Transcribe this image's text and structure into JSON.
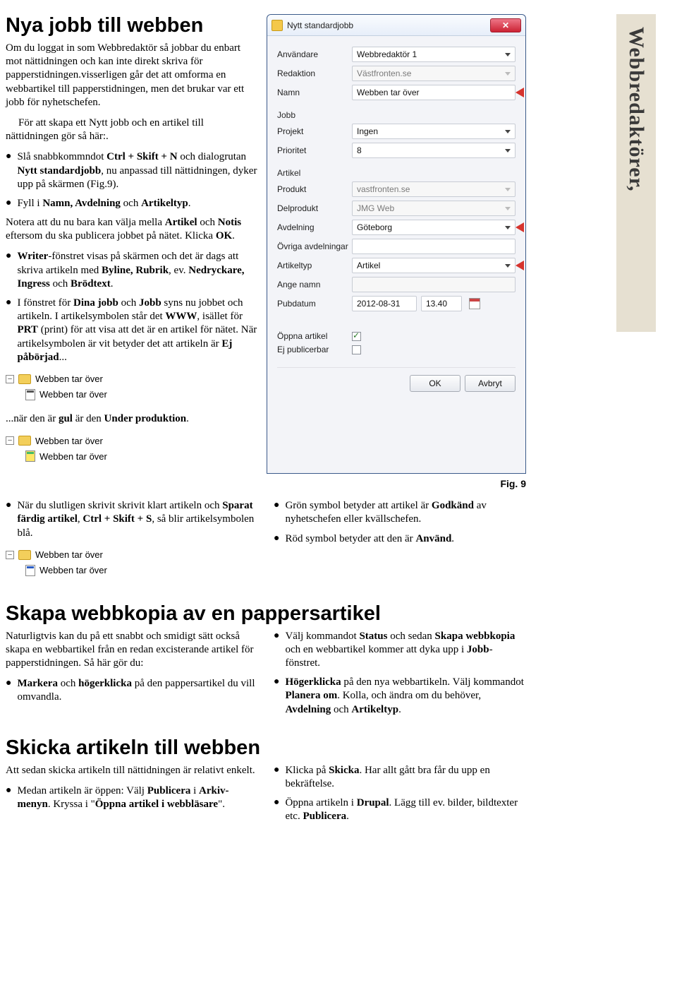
{
  "sideTab": "Webbredaktörer,",
  "h1": "Nya jobb till webben",
  "intro": "Om du loggat in som Webbredaktör så jobbar du enbart mot nättidningen och kan inte direkt skriva för papperstidningen.visserligen går det att omforma en webbartikel till papperstidningen, men det brukar var ett jobb för nyhetschefen.",
  "lead": "För att skapa ett Nytt jobb och en artikel till nättidningen gör så här:.",
  "bul1": {
    "pre": "Slå snabbkommndot ",
    "b1": "Ctrl + Skift + N",
    "mid": " och dialogrutan ",
    "b2": "Nytt standardjobb",
    "post": ", nu anpassad till nättidningen, dyker upp på skärmen (Fig.9)."
  },
  "bul2": {
    "pre": "Fyll i ",
    "b1": "Namn, Avdelning",
    "mid": " och ",
    "b2": "Artikeltyp",
    "post": "."
  },
  "note2": {
    "a": "Notera att du nu bara kan välja mella ",
    "b1": "Artikel",
    "b": " och ",
    "b2": "Notis",
    "c": " eftersom du ska publicera jobbet på nätet. Klicka ",
    "b3": "OK",
    "d": "."
  },
  "bul3": {
    "b1": "Writer",
    "a": "-fönstret visas på skärmen och det är dags att skriva artikeln med ",
    "b2": "Byline, Rubrik",
    "b": ", ev. ",
    "b3": "Nedryckare, Ingress",
    "c": " och ",
    "b4": "Brödtext",
    "d": "."
  },
  "bul4": {
    "a": "I fönstret för ",
    "b1": "Dina jobb",
    "b": " och ",
    "b2": "Jobb",
    "c": " syns nu jobbet och artikeln. I artikelsymbolen står det ",
    "b3": "WWW",
    "d": ", isället för ",
    "b4": "PRT",
    "e": " (print) för att visa att det är en artikel för nätet. När artikelsymbolen är vit betyder det att artikeln är ",
    "b5": "Ej påbörjad",
    "f": "..."
  },
  "underProd": "...när den är gul är den Under produktion.",
  "bul5": {
    "a": "När du slutligen skrivit skrivit klart artikeln och ",
    "b1": "Sparat färdig artikel",
    "b": ", ",
    "b2": "Ctrl + Skift + S",
    "c": ", så blir artikelsymbolen blå."
  },
  "bul6": {
    "a": "Grön symbol betyder att artikel är ",
    "b1": "Godkänd",
    "b": " av nyhetschefen eller kvällschefen."
  },
  "bul7": {
    "a": "Röd symbol betyder att den är ",
    "b1": "Använd",
    "b": "."
  },
  "fig": "Fig. 9",
  "tree": {
    "t1": "Webben tar över",
    "t2": "Webben tar över"
  },
  "h2a": "Skapa webbkopia av en pappersartikel",
  "sk_intro": "Naturligtvis kan du på ett snabbt och smidigt sätt också skapa en webbartikel från en redan excisterande artikel för papperstidningen. Så här gör du:",
  "sk1": {
    "b1": "Markera",
    "a": " och ",
    "b2": "högerklicka",
    "b": " på den pappersartikel du vill omvandla."
  },
  "sk2": {
    "a": "Välj kommandot ",
    "b1": "Status",
    "b": " och sedan ",
    "b2": "Skapa webbkopia",
    "c": " och en webbartikel kommer att dyka upp i ",
    "b3": "Jobb",
    "d": "-fönstret."
  },
  "sk3": {
    "b1": "Högerklicka",
    "a": " på den nya webbartikeln. Välj kommandot ",
    "b2": "Planera om",
    "b": ". Kolla, och ändra om du behöver, ",
    "b3": "Avdelning",
    "c": " och ",
    "b4": "Artikeltyp",
    "d": "."
  },
  "h2b": "Skicka artikeln till webben",
  "sa_intro": "Att sedan skicka artikeln till nättidningen är relativt enkelt.",
  "sa1": {
    "a": "Medan artikeln är öppen: Välj ",
    "b1": "Publicera",
    "b": " i ",
    "b2": "Arkiv-menyn",
    "c": ". Kryssa i \"",
    "b3": "Öppna artikel i webbläsare",
    "d": "\"."
  },
  "sa2": {
    "a": "Klicka på ",
    "b1": "Skicka",
    "b": ". Har allt gått bra får du upp en bekräftelse."
  },
  "sa3": {
    "a": "Öppna artikeln i ",
    "b1": "Drupal",
    "b": ". Lägg till ev. bilder, bildtexter etc. ",
    "b2": "Publicera",
    "c": "."
  },
  "dialog": {
    "title": "Nytt standardjobb",
    "rows": {
      "anvandare": {
        "label": "Användare",
        "value": "Webbredaktör 1"
      },
      "redaktion": {
        "label": "Redaktion",
        "value": "Västfronten.se"
      },
      "namn": {
        "label": "Namn",
        "value": "Webben tar över"
      }
    },
    "sec1": "Jobb",
    "jobb": {
      "projekt": {
        "label": "Projekt",
        "value": "Ingen"
      },
      "prioritet": {
        "label": "Prioritet",
        "value": "8"
      }
    },
    "sec2": "Artikel",
    "artikel": {
      "produkt": {
        "label": "Produkt",
        "value": "vastfronten.se"
      },
      "delprodukt": {
        "label": "Delprodukt",
        "value": "JMG Web"
      },
      "avdelning": {
        "label": "Avdelning",
        "value": "Göteborg"
      },
      "ovriga": {
        "label": "Övriga avdelningar",
        "value": ""
      },
      "artikeltyp": {
        "label": "Artikeltyp",
        "value": "Artikel"
      },
      "angenamn": {
        "label": "Ange namn",
        "value": ""
      },
      "pubdatum": {
        "label": "Pubdatum",
        "date": "2012-08-31",
        "time": "13.40"
      },
      "oppna": {
        "label": "Öppna artikel"
      },
      "ejpub": {
        "label": "Ej publicerbar"
      }
    },
    "ok": "OK",
    "cancel": "Avbryt"
  }
}
